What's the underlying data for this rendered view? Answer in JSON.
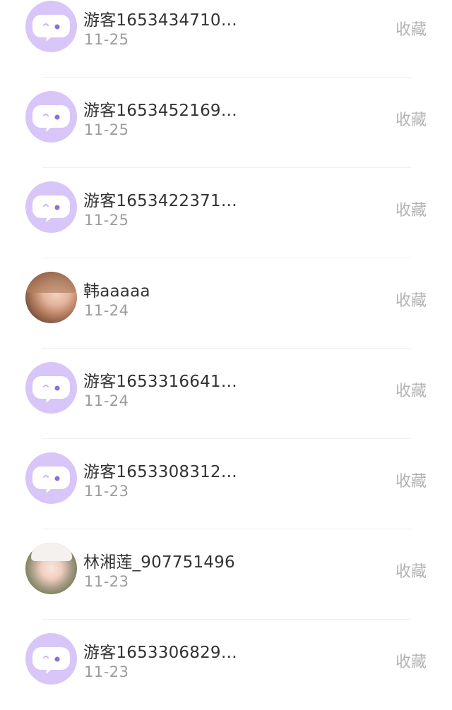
{
  "colors": {
    "avatar_default_bg": "#d7c6f7",
    "name_text": "#333333",
    "date_text": "#9c9c9c",
    "action_text": "#b3b3b3"
  },
  "items": [
    {
      "name": "游客1653434710…",
      "date": "11-25",
      "action": "收藏",
      "avatar": "default-chat-avatar"
    },
    {
      "name": "游客1653452169…",
      "date": "11-25",
      "action": "收藏",
      "avatar": "default-chat-avatar"
    },
    {
      "name": "游客1653422371…",
      "date": "11-25",
      "action": "收藏",
      "avatar": "default-chat-avatar"
    },
    {
      "name": "韩aaaaa",
      "date": "11-24",
      "action": "收藏",
      "avatar": "user-photo"
    },
    {
      "name": "游客1653316641…",
      "date": "11-24",
      "action": "收藏",
      "avatar": "default-chat-avatar"
    },
    {
      "name": "游客1653308312…",
      "date": "11-23",
      "action": "收藏",
      "avatar": "default-chat-avatar"
    },
    {
      "name": "林湘莲_907751496",
      "date": "11-23",
      "action": "收藏",
      "avatar": "user-photo"
    },
    {
      "name": "游客1653306829…",
      "date": "11-23",
      "action": "收藏",
      "avatar": "default-chat-avatar"
    }
  ]
}
